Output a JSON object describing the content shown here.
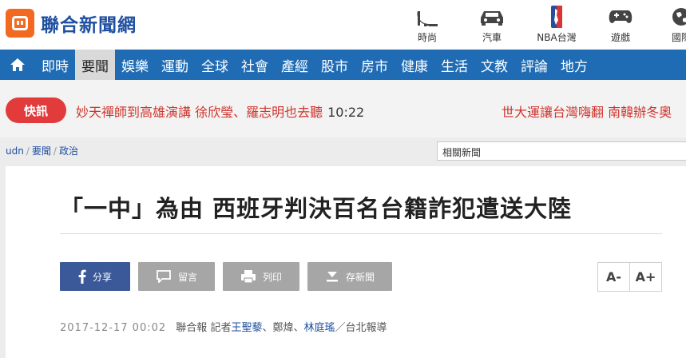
{
  "brand": {
    "name": "聯合新聞網",
    "color": "#f26a21"
  },
  "quick_links": [
    {
      "label": "時尚",
      "icon": "high-heel-icon"
    },
    {
      "label": "汽車",
      "icon": "car-icon"
    },
    {
      "label": "NBA台灣",
      "icon": "nba-icon"
    },
    {
      "label": "遊戲",
      "icon": "gamepad-icon"
    },
    {
      "label": "國際",
      "icon": "globe-icon"
    }
  ],
  "nav": {
    "home_icon": "home-icon",
    "items": [
      "即時",
      "要聞",
      "娛樂",
      "運動",
      "全球",
      "社會",
      "產經",
      "股市",
      "房市",
      "健康",
      "生活",
      "文教",
      "評論",
      "地方"
    ],
    "active": "要聞",
    "color": "#1f6cb5"
  },
  "flash": {
    "badge": "快訊",
    "headline": "妙天禪師到高雄演講 徐欣瑩、羅志明也去聽",
    "time": "10:22",
    "headline2": "世大運讓台灣嗨翻 南韓辦冬奧"
  },
  "breadcrumb": [
    "udn",
    "要聞",
    "政治"
  ],
  "related_label": "相關新聞",
  "article": {
    "title": "「一中」為由 西班牙判決百名台籍詐犯遣送大陸",
    "actions": {
      "share": "分享",
      "comment": "留言",
      "print": "列印",
      "save": "存新聞"
    },
    "font_smaller": "A-",
    "font_larger": "A+",
    "date": "2017-12-17 00:02",
    "source": "聯合報",
    "reporter_prefix": "記者",
    "reporter1": "王聖藜",
    "sep1": "、",
    "reporter2": "鄭煒",
    "sep2": "、",
    "reporter3": "林庭瑤",
    "suffix": "／台北報導"
  }
}
